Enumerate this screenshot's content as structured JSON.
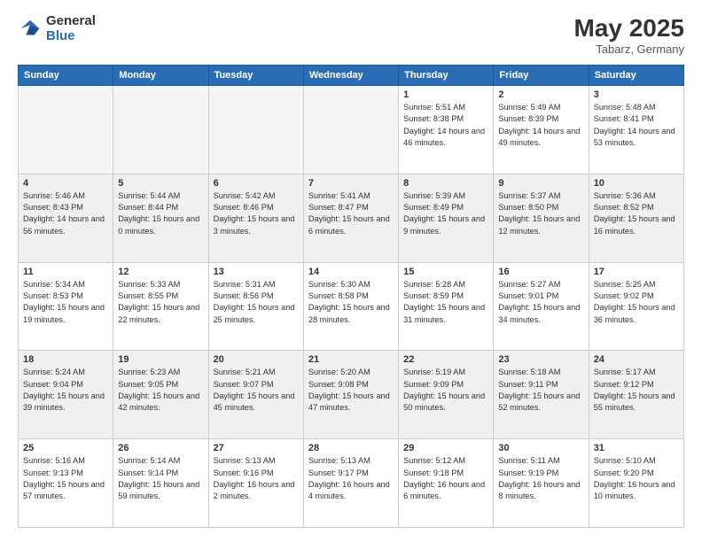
{
  "header": {
    "logo_general": "General",
    "logo_blue": "Blue",
    "month_year": "May 2025",
    "location": "Tabarz, Germany"
  },
  "days_of_week": [
    "Sunday",
    "Monday",
    "Tuesday",
    "Wednesday",
    "Thursday",
    "Friday",
    "Saturday"
  ],
  "weeks": [
    [
      {
        "day": "",
        "empty": true
      },
      {
        "day": "",
        "empty": true
      },
      {
        "day": "",
        "empty": true
      },
      {
        "day": "",
        "empty": true
      },
      {
        "day": "1",
        "sunrise": "5:51 AM",
        "sunset": "8:38 PM",
        "daylight": "14 hours and 46 minutes."
      },
      {
        "day": "2",
        "sunrise": "5:49 AM",
        "sunset": "8:39 PM",
        "daylight": "14 hours and 49 minutes."
      },
      {
        "day": "3",
        "sunrise": "5:48 AM",
        "sunset": "8:41 PM",
        "daylight": "14 hours and 53 minutes."
      }
    ],
    [
      {
        "day": "4",
        "sunrise": "5:46 AM",
        "sunset": "8:43 PM",
        "daylight": "14 hours and 56 minutes."
      },
      {
        "day": "5",
        "sunrise": "5:44 AM",
        "sunset": "8:44 PM",
        "daylight": "15 hours and 0 minutes."
      },
      {
        "day": "6",
        "sunrise": "5:42 AM",
        "sunset": "8:46 PM",
        "daylight": "15 hours and 3 minutes."
      },
      {
        "day": "7",
        "sunrise": "5:41 AM",
        "sunset": "8:47 PM",
        "daylight": "15 hours and 6 minutes."
      },
      {
        "day": "8",
        "sunrise": "5:39 AM",
        "sunset": "8:49 PM",
        "daylight": "15 hours and 9 minutes."
      },
      {
        "day": "9",
        "sunrise": "5:37 AM",
        "sunset": "8:50 PM",
        "daylight": "15 hours and 12 minutes."
      },
      {
        "day": "10",
        "sunrise": "5:36 AM",
        "sunset": "8:52 PM",
        "daylight": "15 hours and 16 minutes."
      }
    ],
    [
      {
        "day": "11",
        "sunrise": "5:34 AM",
        "sunset": "8:53 PM",
        "daylight": "15 hours and 19 minutes."
      },
      {
        "day": "12",
        "sunrise": "5:33 AM",
        "sunset": "8:55 PM",
        "daylight": "15 hours and 22 minutes."
      },
      {
        "day": "13",
        "sunrise": "5:31 AM",
        "sunset": "8:56 PM",
        "daylight": "15 hours and 25 minutes."
      },
      {
        "day": "14",
        "sunrise": "5:30 AM",
        "sunset": "8:58 PM",
        "daylight": "15 hours and 28 minutes."
      },
      {
        "day": "15",
        "sunrise": "5:28 AM",
        "sunset": "8:59 PM",
        "daylight": "15 hours and 31 minutes."
      },
      {
        "day": "16",
        "sunrise": "5:27 AM",
        "sunset": "9:01 PM",
        "daylight": "15 hours and 34 minutes."
      },
      {
        "day": "17",
        "sunrise": "5:25 AM",
        "sunset": "9:02 PM",
        "daylight": "15 hours and 36 minutes."
      }
    ],
    [
      {
        "day": "18",
        "sunrise": "5:24 AM",
        "sunset": "9:04 PM",
        "daylight": "15 hours and 39 minutes."
      },
      {
        "day": "19",
        "sunrise": "5:23 AM",
        "sunset": "9:05 PM",
        "daylight": "15 hours and 42 minutes."
      },
      {
        "day": "20",
        "sunrise": "5:21 AM",
        "sunset": "9:07 PM",
        "daylight": "15 hours and 45 minutes."
      },
      {
        "day": "21",
        "sunrise": "5:20 AM",
        "sunset": "9:08 PM",
        "daylight": "15 hours and 47 minutes."
      },
      {
        "day": "22",
        "sunrise": "5:19 AM",
        "sunset": "9:09 PM",
        "daylight": "15 hours and 50 minutes."
      },
      {
        "day": "23",
        "sunrise": "5:18 AM",
        "sunset": "9:11 PM",
        "daylight": "15 hours and 52 minutes."
      },
      {
        "day": "24",
        "sunrise": "5:17 AM",
        "sunset": "9:12 PM",
        "daylight": "15 hours and 55 minutes."
      }
    ],
    [
      {
        "day": "25",
        "sunrise": "5:16 AM",
        "sunset": "9:13 PM",
        "daylight": "15 hours and 57 minutes."
      },
      {
        "day": "26",
        "sunrise": "5:14 AM",
        "sunset": "9:14 PM",
        "daylight": "15 hours and 59 minutes."
      },
      {
        "day": "27",
        "sunrise": "5:13 AM",
        "sunset": "9:16 PM",
        "daylight": "16 hours and 2 minutes."
      },
      {
        "day": "28",
        "sunrise": "5:13 AM",
        "sunset": "9:17 PM",
        "daylight": "16 hours and 4 minutes."
      },
      {
        "day": "29",
        "sunrise": "5:12 AM",
        "sunset": "9:18 PM",
        "daylight": "16 hours and 6 minutes."
      },
      {
        "day": "30",
        "sunrise": "5:11 AM",
        "sunset": "9:19 PM",
        "daylight": "16 hours and 8 minutes."
      },
      {
        "day": "31",
        "sunrise": "5:10 AM",
        "sunset": "9:20 PM",
        "daylight": "16 hours and 10 minutes."
      }
    ]
  ]
}
